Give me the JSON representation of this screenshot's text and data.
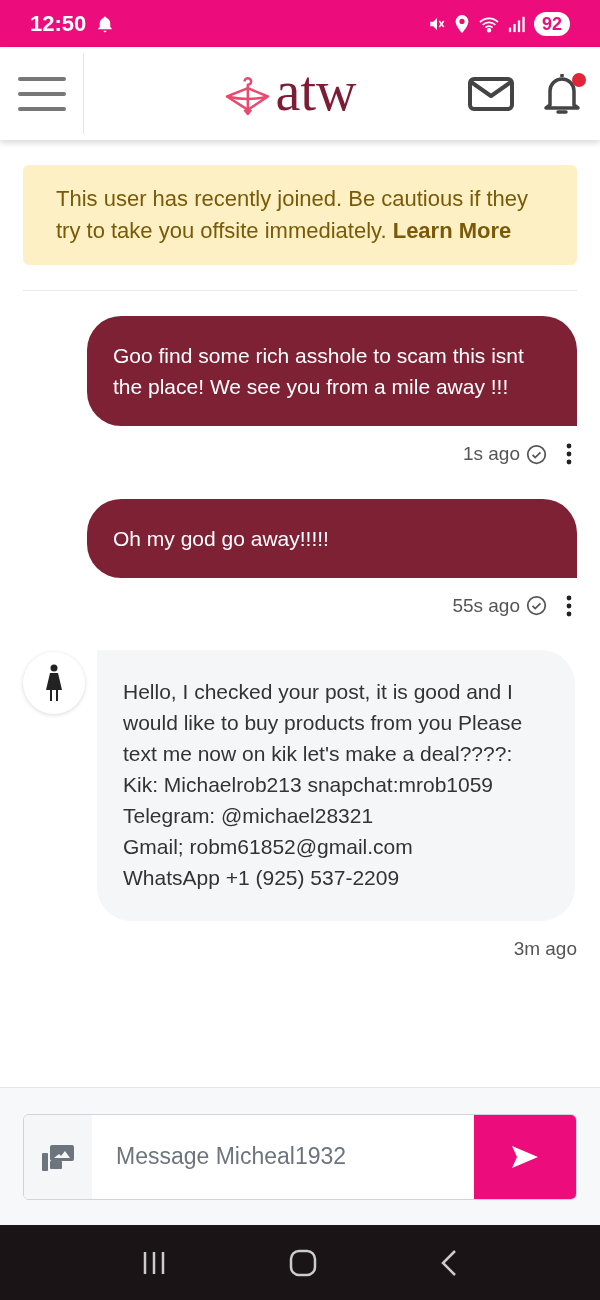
{
  "status_bar": {
    "time": "12:50",
    "battery": "92"
  },
  "header": {
    "logo_text": "atw",
    "unread_notifications": true
  },
  "notice": {
    "text": "This user has recently joined. Be cautious if they try to take you offsite immediately.",
    "link": "Learn More"
  },
  "messages": [
    {
      "kind": "sent",
      "text": "Goo find some rich asshole to scam this isnt the place! We see you from a mile away !!!",
      "time": "1s ago"
    },
    {
      "kind": "sent",
      "text": "Oh my god go away!!!!!",
      "time": "55s ago"
    },
    {
      "kind": "received",
      "text": "Hello, I checked your post, it is good and I would like to buy products from you Please text me now on kik let's make a deal????: Kik: Michaelrob213 snapchat:mrob1059 Telegram: @michael28321\nGmail; robm61852@gmail.com\nWhatsApp +1 (925) 537-2209",
      "time": "3m ago"
    }
  ],
  "composer": {
    "placeholder": "Message Micheal1932"
  }
}
